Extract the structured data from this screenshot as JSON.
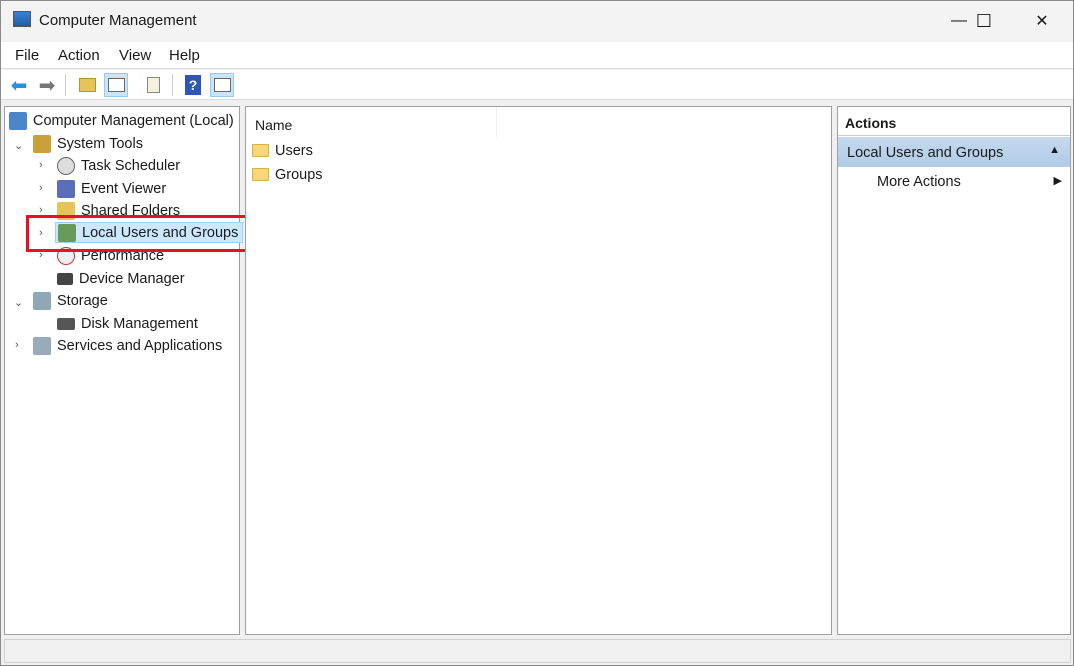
{
  "window": {
    "title": "Computer Management",
    "controls": {
      "minimize": "—",
      "maximize": "☐",
      "close": "✕"
    }
  },
  "menu": [
    "File",
    "Action",
    "View",
    "Help"
  ],
  "toolbar": [
    "back-icon",
    "forward-icon",
    "up-folder-icon",
    "show-hide-tree-icon",
    "export-list-icon",
    "help-icon",
    "show-hide-action-pane-icon"
  ],
  "tree": {
    "root": "Computer Management (Local)",
    "system_tools": "System Tools",
    "task_scheduler": "Task Scheduler",
    "event_viewer": "Event Viewer",
    "shared_folders": "Shared Folders",
    "local_users": "Local Users and Groups",
    "performance": "Performance",
    "device_manager": "Device Manager",
    "storage": "Storage",
    "disk_management": "Disk Management",
    "services": "Services and Applications"
  },
  "list": {
    "column": "Name",
    "items": [
      "Users",
      "Groups"
    ]
  },
  "actions": {
    "header": "Actions",
    "section": "Local Users and Groups",
    "more": "More Actions"
  },
  "colors": {
    "selection": "#cce8ff",
    "highlight_box": "#e81123",
    "actions_section": "#b9d1ea"
  }
}
